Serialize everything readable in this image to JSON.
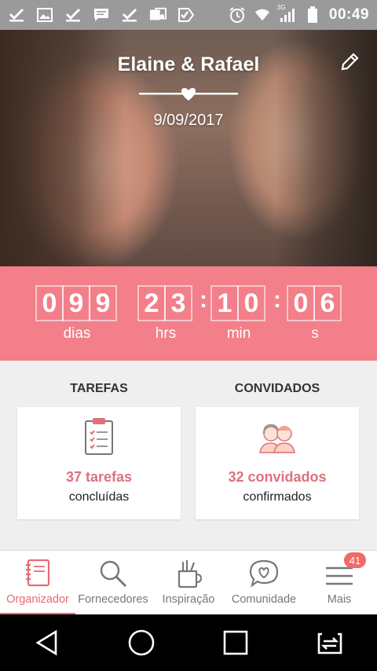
{
  "status_bar": {
    "time": "00:49",
    "network_label": "3G"
  },
  "hero": {
    "title": "Elaine & Rafael",
    "date": "9/09/2017"
  },
  "countdown": {
    "days_digits": [
      "0",
      "9",
      "9"
    ],
    "hours_digits": [
      "2",
      "3"
    ],
    "minutes_digits": [
      "1",
      "0"
    ],
    "seconds_digits": [
      "0",
      "6"
    ],
    "labels": {
      "days": "dias",
      "hours": "hrs",
      "minutes": "min",
      "seconds": "s"
    },
    "color": "#f27f8a"
  },
  "sections": {
    "tasks": {
      "heading": "TAREFAS",
      "count": "37 tarefas",
      "sub": "concluídas"
    },
    "guests": {
      "heading": "CONVIDADOS",
      "count": "32 convidados",
      "sub": "confirmados"
    }
  },
  "bottom_nav": {
    "items": [
      {
        "label": "Organizador",
        "icon": "notebook-icon"
      },
      {
        "label": "Fornecedores",
        "icon": "search-icon"
      },
      {
        "label": "Inspiração",
        "icon": "pencil-cup-icon"
      },
      {
        "label": "Comunidade",
        "icon": "chat-heart-icon"
      },
      {
        "label": "Mais",
        "icon": "menu-icon",
        "badge": "41"
      }
    ],
    "active_index": 0,
    "accent_color": "#e66b78"
  }
}
